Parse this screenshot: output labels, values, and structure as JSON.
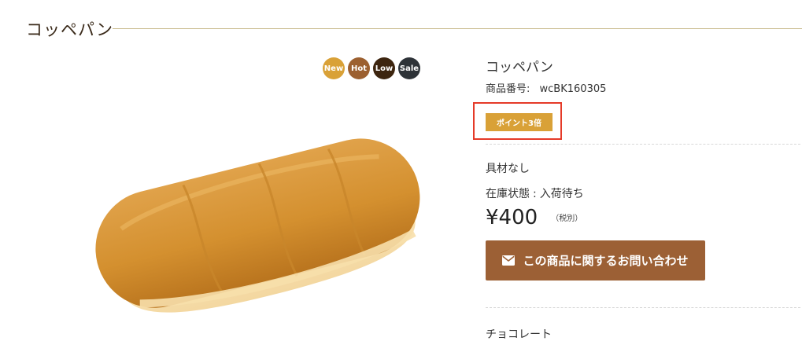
{
  "page": {
    "title": "コッペパン"
  },
  "badges": {
    "new": "New",
    "hot": "Hot",
    "low": "Low",
    "sale": "Sale"
  },
  "product": {
    "name": "コッペパン",
    "code_label": "商品番号:",
    "code_value": "wcBK160305",
    "point_badge": "ポイント3倍",
    "option": "具材なし",
    "stock_label": "在庫状態",
    "stock_sep": ":",
    "stock_value": "入荷待ち",
    "price": "¥400",
    "tax_note": "（税別）",
    "contact_button": "この商品に関するお問い合わせ",
    "next_option": "チョコレート"
  },
  "colors": {
    "accent_gold": "#d9a137",
    "brand_brown": "#9c6035",
    "highlight_red": "#e53a28"
  },
  "icons": {
    "contact": "envelope-icon"
  }
}
